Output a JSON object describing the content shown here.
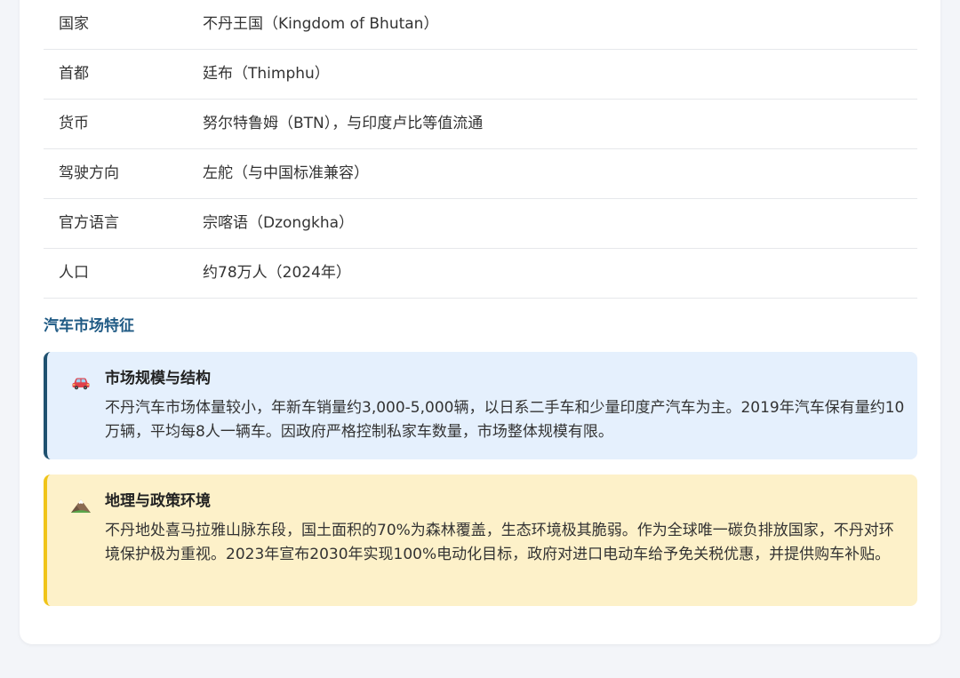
{
  "info_table": {
    "rows": [
      {
        "label": "国家",
        "value": "不丹王国（Kingdom of Bhutan）"
      },
      {
        "label": "首都",
        "value": "廷布（Thimphu）"
      },
      {
        "label": "货币",
        "value": "努尔特鲁姆（BTN），与印度卢比等值流通"
      },
      {
        "label": "驾驶方向",
        "value": "左舵（与中国标准兼容）"
      },
      {
        "label": "官方语言",
        "value": "宗喀语（Dzongkha）"
      },
      {
        "label": "人口",
        "value": "约78万人（2024年）"
      }
    ]
  },
  "section": {
    "title": "汽车市场特征"
  },
  "features": [
    {
      "icon": "car-icon",
      "heading": "市场规模与结构",
      "body": "不丹汽车市场体量较小，年新车销量约3,000-5,000辆，以日系二手车和少量印度产汽车为主。2019年汽车保有量约10万辆，平均每8人一辆车。因政府严格控制私家车数量，市场整体规模有限。",
      "accent": "#1f5170",
      "background": "#e5f0fd"
    },
    {
      "icon": "mountain-icon",
      "heading": "地理与政策环境",
      "body": "不丹地处喜马拉雅山脉东段，国土面积的70%为森林覆盖，生态环境极其脆弱。作为全球唯一碳负排放国家，不丹对环境保护极为重视。2023年宣布2030年实现100%电动化目标，政府对进口电动车给予免关税优惠，并提供购车补贴。",
      "accent": "#f0c419",
      "background": "#fdf1c9"
    }
  ]
}
